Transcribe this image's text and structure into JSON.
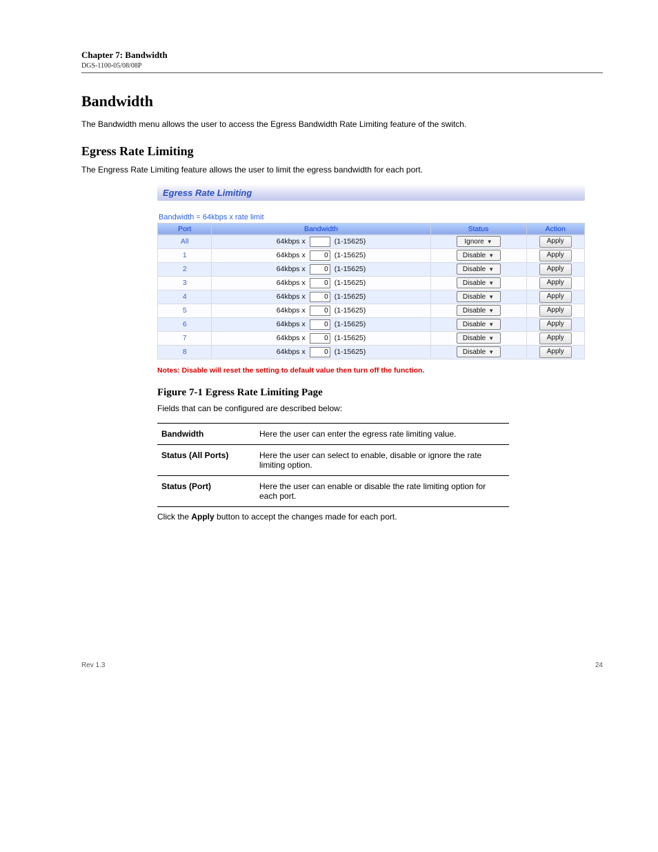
{
  "header": {
    "title": "Chapter 7: Bandwidth",
    "subtitle": "DGS-1100-05/08/08P"
  },
  "intro": {
    "heading": "Bandwidth",
    "text": "The Bandwidth menu allows the user to access the Egress Bandwidth Rate Limiting feature of the switch."
  },
  "egress": {
    "heading": "Egress Rate Limiting",
    "intro": "The Engress Rate Limiting feature allows the user to limit the egress bandwidth for each port.",
    "panel": {
      "title": "Egress Rate Limiting",
      "formula": "Bandwidth = 64kbps x rate limit",
      "columns": {
        "port": "Port",
        "bandwidth": "Bandwidth",
        "status": "Status",
        "action": "Action"
      },
      "bw_prefix": "64kbps x",
      "bw_range": "(1-15625)",
      "apply_label": "Apply",
      "note": "Notes: Disable will reset the setting to default value then turn off the function.",
      "rows": [
        {
          "port": "All",
          "value": "",
          "status": "Ignore"
        },
        {
          "port": "1",
          "value": "0",
          "status": "Disable"
        },
        {
          "port": "2",
          "value": "0",
          "status": "Disable"
        },
        {
          "port": "3",
          "value": "0",
          "status": "Disable"
        },
        {
          "port": "4",
          "value": "0",
          "status": "Disable"
        },
        {
          "port": "5",
          "value": "0",
          "status": "Disable"
        },
        {
          "port": "6",
          "value": "0",
          "status": "Disable"
        },
        {
          "port": "7",
          "value": "0",
          "status": "Disable"
        },
        {
          "port": "8",
          "value": "0",
          "status": "Disable"
        }
      ]
    },
    "figure_caption": "Figure 7-1 Egress Rate Limiting Page",
    "def_intro": "Fields that can be configured are described below:",
    "defs": [
      {
        "term": "Bandwidth",
        "desc": "Here the user can enter the egress rate limiting value."
      },
      {
        "term": "Status (All Ports)",
        "desc": "Here the user can select to enable, disable or ignore the rate limiting option."
      },
      {
        "term": "Status (Port)",
        "desc": "Here the user can enable or disable the rate limiting option for each port."
      }
    ],
    "apply_paragraph": "Click the Apply button to accept the changes made for each port."
  },
  "footer": {
    "left": "Rev 1.3",
    "right": "24"
  }
}
